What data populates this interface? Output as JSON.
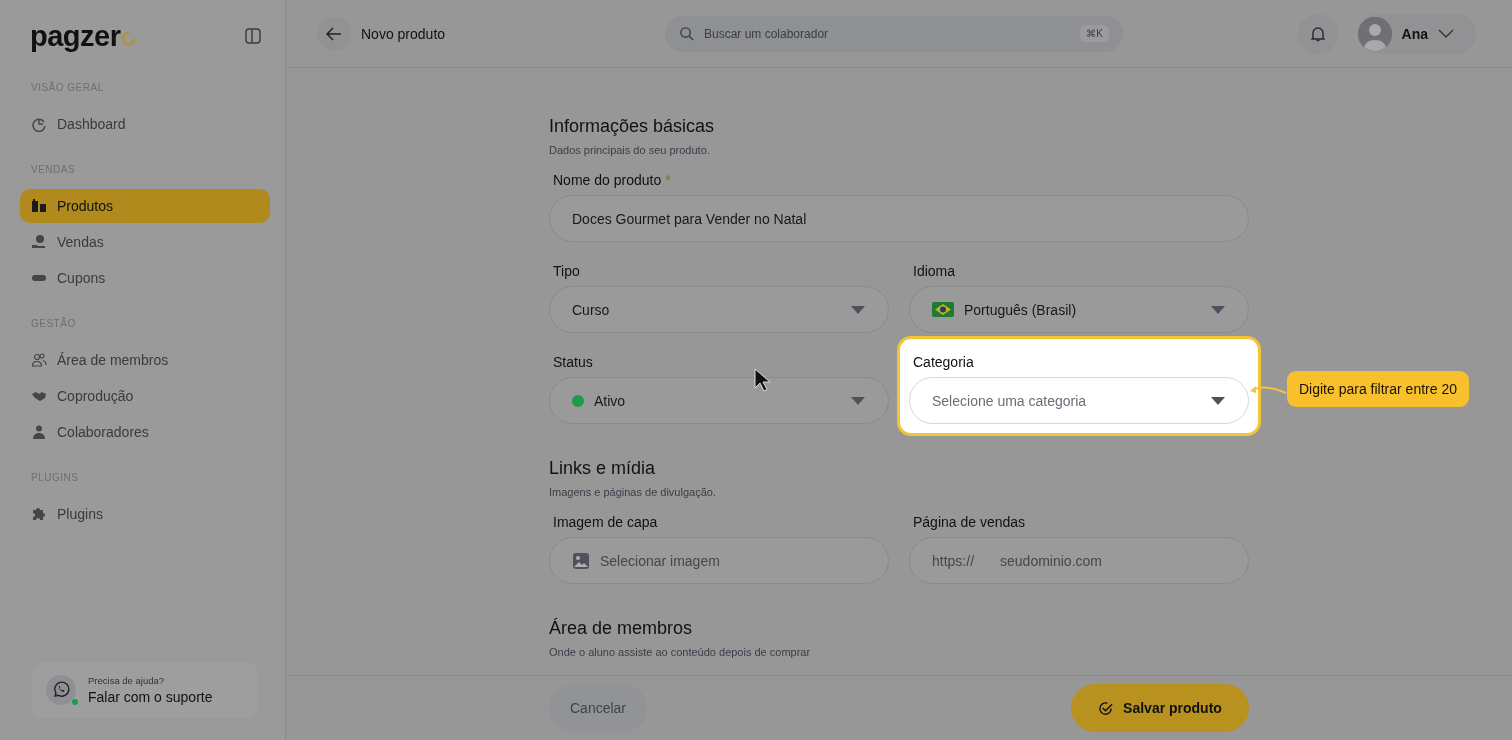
{
  "sidebar": {
    "logo": "pagzer",
    "sections": [
      {
        "title": "VISÃO GERAL",
        "items": [
          {
            "label": "Dashboard",
            "selected": false
          }
        ]
      },
      {
        "title": "VENDAS",
        "items": [
          {
            "label": "Produtos",
            "selected": true
          },
          {
            "label": "Vendas",
            "selected": false
          },
          {
            "label": "Cupons",
            "selected": false
          }
        ]
      },
      {
        "title": "GESTÃO",
        "items": [
          {
            "label": "Área de membros",
            "selected": false
          },
          {
            "label": "Coprodução",
            "selected": false
          },
          {
            "label": "Colaboradores",
            "selected": false
          }
        ]
      },
      {
        "title": "PLUGINS",
        "items": [
          {
            "label": "Plugins",
            "selected": false
          }
        ]
      }
    ],
    "support": {
      "question": "Precisa de ajuda?",
      "action": "Falar com o suporte"
    }
  },
  "topbar": {
    "title": "Novo produto",
    "search": {
      "placeholder": "Buscar um colaborador",
      "shortcut": "⌘K"
    },
    "user": "Ana"
  },
  "sections": [
    {
      "title": "Informações básicas",
      "subtitle": "Dados principais do seu produto.",
      "fields": [
        {
          "kind": "text",
          "label": "Nome do produto",
          "required_mark": "*",
          "value": "Doces Gourmet para Vender no Natal",
          "wide": true,
          "highlighted": false
        },
        {
          "kind": "select",
          "label": "Tipo",
          "value": "Curso",
          "highlighted": false
        },
        {
          "kind": "language-select",
          "label": "Idioma",
          "value": "Português (Brasil)",
          "highlighted": false
        },
        {
          "kind": "status-select",
          "label": "Status",
          "value": "Ativo",
          "color": "#1f9a48",
          "highlighted": false
        },
        {
          "kind": "select",
          "label": "Categoria",
          "placeholder": "Selecione uma categoria",
          "highlighted": true,
          "tooltip": "Digite para filtrar entre 20"
        }
      ]
    },
    {
      "title": "Links e mídia",
      "subtitle": "Imagens e páginas de divulgação.",
      "fields": [
        {
          "kind": "image",
          "label": "Imagem de capa",
          "placeholder": "Selecionar imagem",
          "highlighted": false
        },
        {
          "kind": "url",
          "label": "Página de vendas",
          "prefix": "https://",
          "placeholder": "seudominio.com",
          "highlighted": false
        }
      ]
    },
    {
      "title": "Área de membros",
      "subtitle": "Onde o aluno assiste ao conteúdo depois de comprar"
    }
  ],
  "footer": {
    "cancel": "Cancelar",
    "save": "Salvar produto"
  }
}
